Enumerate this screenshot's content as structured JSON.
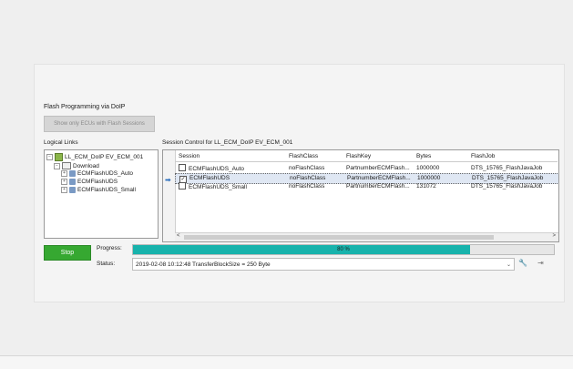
{
  "panel": {
    "title": "Flash Programming via DoIP",
    "ecu_button": "Show only ECUs with Flash Sessions",
    "logical_links_label": "Logical Links",
    "session_control_label": "Session Control for LL_ECM_DoIP EV_ECM_001"
  },
  "tree": {
    "root": "LL_ECM_DoIP EV_ECM_001",
    "group": "Download",
    "items": [
      "ECMFlashUDS_Auto",
      "ECMFlashUDS",
      "ECMFlashUDS_Small"
    ]
  },
  "table": {
    "headers": [
      "Session",
      "FlashClass",
      "FlashKey",
      "Bytes",
      "FlashJob"
    ],
    "rows": [
      {
        "session": "ECMFlashUDS_Auto",
        "flashclass": "noFlashClass",
        "flashkey": "PartnumberECMFlash...",
        "bytes": "1000000",
        "flashjob": "DTS_15765_FlashJavaJob",
        "checked": false
      },
      {
        "session": "ECMFlashUDS",
        "flashclass": "noFlashClass",
        "flashkey": "PartnumberECMFlash...",
        "bytes": "1000000",
        "flashjob": "DTS_15765_FlashJavaJob",
        "checked": true
      },
      {
        "session": "ECMFlashUDS_Small",
        "flashclass": "noFlashClass",
        "flashkey": "PartnumberECMFlash...",
        "bytes": "131072",
        "flashjob": "DTS_15765_FlashJavaJob",
        "checked": false
      }
    ]
  },
  "controls": {
    "stop_label": "Stop",
    "progress_label": "Progress:",
    "status_label": "Status:",
    "progress_text": "80 %",
    "progress_value": 0.8,
    "status_text": "2019-02-08 10:12:48  TransferBlockSize = 250 Byte"
  },
  "colors": {
    "progress_fill": "#18b3ac",
    "stop_button": "#36a831"
  },
  "icons": {
    "selected_row": "arrow-right-icon",
    "tool1": "wrench-icon",
    "tool2": "export-icon"
  }
}
